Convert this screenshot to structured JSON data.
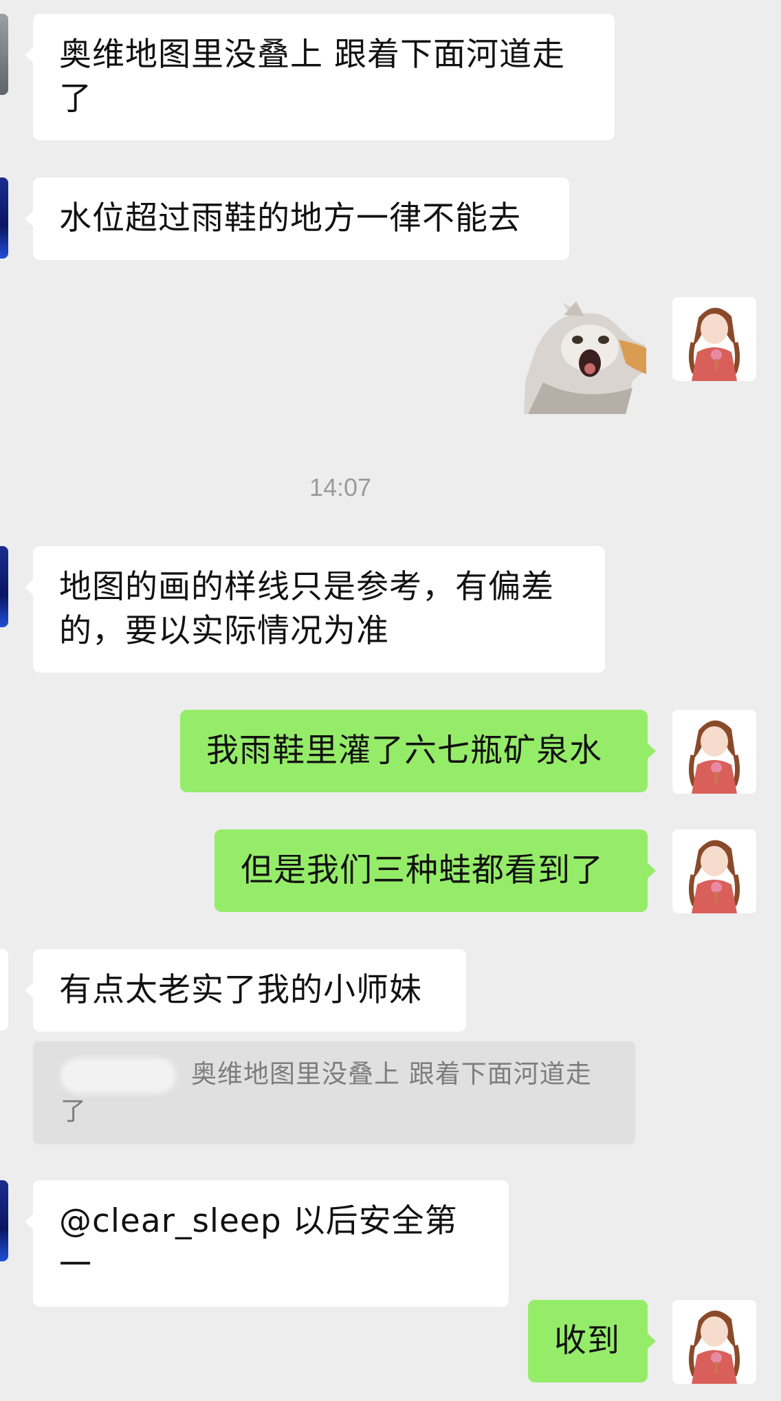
{
  "messages": [
    {
      "side": "left",
      "text": "奥维地图里没叠上 跟着下面河道走了"
    },
    {
      "side": "left",
      "text": "水位超过雨鞋的地方一律不能去"
    },
    {
      "side": "right",
      "type": "sticker",
      "sticker_icon": "startled-cat-sticker"
    },
    {
      "side": "left",
      "text": "地图的画的样线只是参考，有偏差的，要以实际情况为准"
    },
    {
      "side": "right",
      "text": "我雨鞋里灌了六七瓶矿泉水"
    },
    {
      "side": "right",
      "text": "但是我们三种蛙都看到了"
    },
    {
      "side": "left",
      "text": "有点太老实了我的小师妹"
    },
    {
      "side": "left",
      "text": "@clear_sleep 以后安全第一"
    },
    {
      "side": "right",
      "text": "收到"
    }
  ],
  "timestamp": "14:07",
  "quote": {
    "text": "奥维地图里没叠上 跟着下面河道走了"
  },
  "colors": {
    "background": "#ededed",
    "incoming_bubble": "#ffffff",
    "outgoing_bubble": "#95ec69",
    "quote_background": "#e0e0e0"
  },
  "icons": {
    "self_avatar": "anime-girl-avatar",
    "other_avatars": "cropped-avatar"
  }
}
